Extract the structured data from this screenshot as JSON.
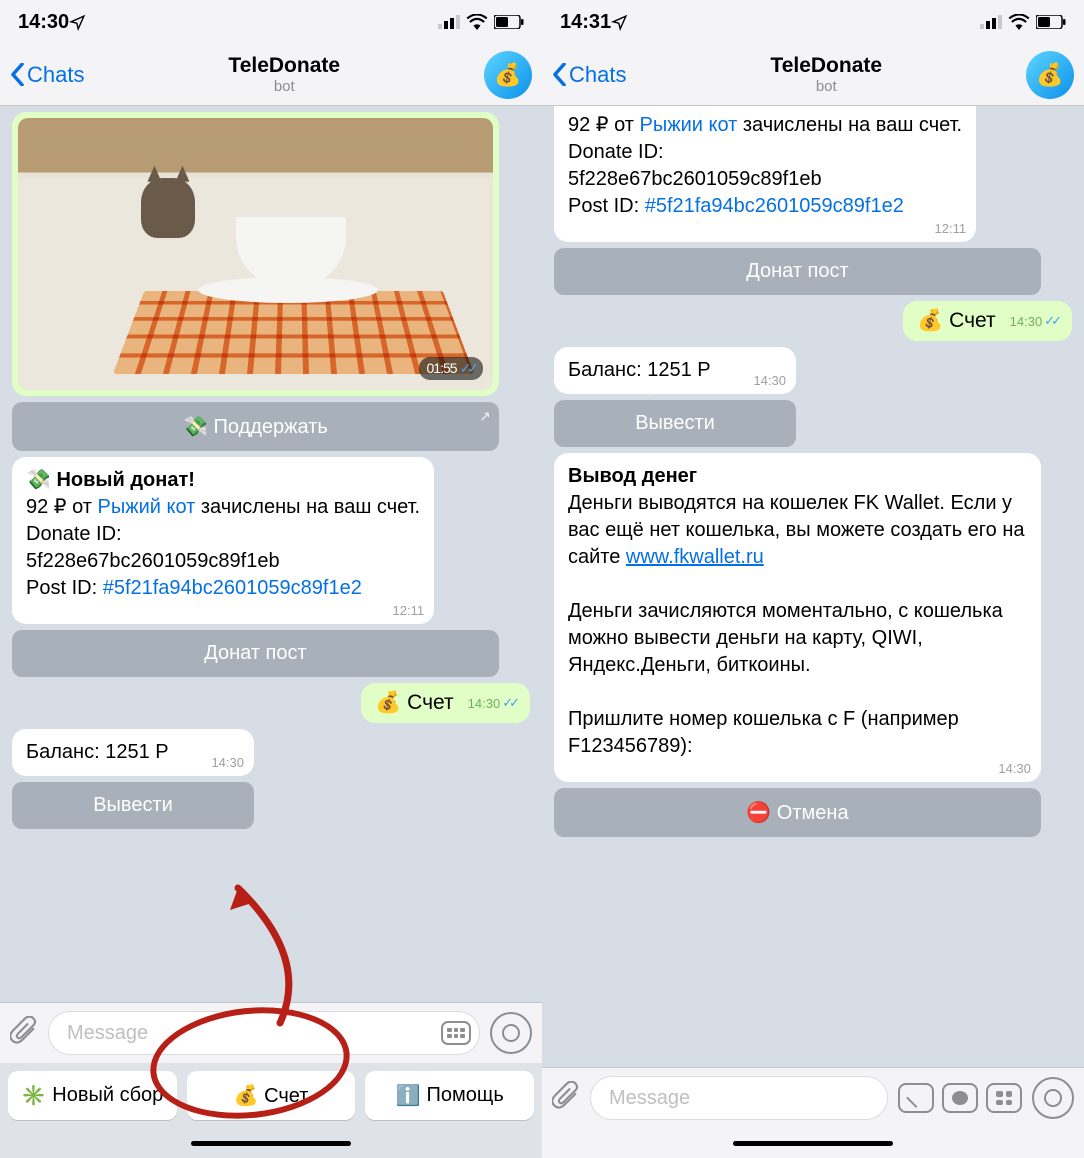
{
  "left": {
    "status_time": "14:30",
    "back_label": "Chats",
    "title": "TeleDonate",
    "subtitle": "bot",
    "video_time": "01:55",
    "support_btn": "💸 Поддержать",
    "donation": {
      "title": "💸  Новый донат!",
      "amount_text_prefix": "92 ₽ от ",
      "from_name": "Рыжий кот",
      "amount_text_suffix": " зачислены на ваш счет.",
      "donate_id_label": "Donate ID:",
      "donate_id": "5f228e67bc2601059c89f1eb",
      "post_id_label": "Post ID: ",
      "post_id": "#5f21fa94bc2601059c89f1e2",
      "time": "12:11"
    },
    "donate_post_btn": "Донат пост",
    "account_msg": "💰 Счет",
    "account_time": "14:30",
    "balance_text": "Баланс: 1251 Р",
    "balance_time": "14:30",
    "withdraw_btn": "Вывести",
    "input_placeholder": "Message",
    "kbd_new": "Новый сбор",
    "kbd_account": "💰  Счет",
    "kbd_help": "Помощь"
  },
  "right": {
    "status_time": "14:31",
    "back_label": "Chats",
    "title": "TeleDonate",
    "subtitle": "bot",
    "top_msg": {
      "prefix": "92 ₽ от ",
      "from_name": "Рыжии кот",
      "suffix": " зачислены на ваш счет.",
      "donate_id_label": "Donate ID:",
      "donate_id": "5f228e67bc2601059c89f1eb",
      "post_id_label": "Post ID: ",
      "post_id": "#5f21fa94bc2601059c89f1e2",
      "time": "12:11"
    },
    "donate_post_btn": "Донат пост",
    "account_msg": "💰 Счет",
    "account_time": "14:30",
    "balance_text": "Баланс: 1251 Р",
    "balance_time": "14:30",
    "withdraw_btn": "Вывести",
    "withdraw_info": {
      "title": "Вывод денег",
      "p1a": "Деньги выводятся на кошелек FK Wallet. Если у вас ещё нет кошелька, вы можете создать его на сайте ",
      "link": "www.fkwallet.ru",
      "p2": "Деньги зачисляются моментально, с кошелька можно вывести деньги на карту, QIWI, Яндекс.Деньги, биткоины.",
      "p3": "Пришлите номер кошелька с F (например F123456789):",
      "time": "14:30"
    },
    "cancel_btn": "⛔ Отмена",
    "input_placeholder": "Message"
  }
}
